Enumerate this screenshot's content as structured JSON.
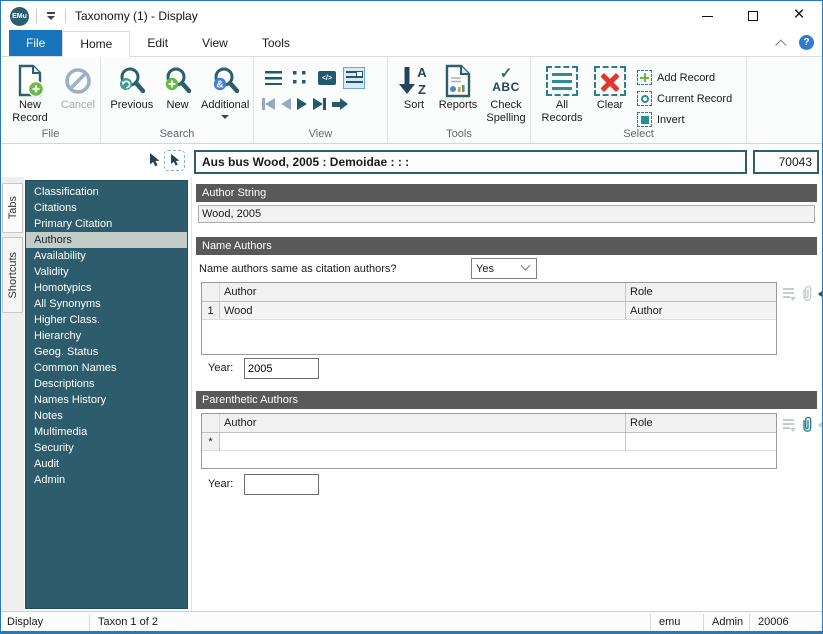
{
  "window": {
    "title": "Taxonomy (1) - Display",
    "logo_text": "EMu"
  },
  "ribbon": {
    "tabs": {
      "file": "File",
      "home": "Home",
      "edit": "Edit",
      "view": "View",
      "tools": "Tools"
    },
    "groups": {
      "file": {
        "label": "File",
        "new_record": "New\nRecord",
        "cancel": "Cancel"
      },
      "search": {
        "label": "Search",
        "previous": "Previous",
        "new": "New",
        "additional": "Additional"
      },
      "view": {
        "label": "View"
      },
      "tools": {
        "label": "Tools",
        "sort": "Sort",
        "reports": "Reports",
        "check_spelling": "Check\nSpelling"
      },
      "select": {
        "label": "Select",
        "all_records": "All\nRecords",
        "clear": "Clear",
        "add_record": "Add Record",
        "current_record": "Current Record",
        "invert": "Invert"
      }
    }
  },
  "record_header": {
    "summary": "Aus bus Wood, 2005 : Demoidae : : :",
    "record_number": "70043"
  },
  "side_tabs": {
    "tabs": "Tabs",
    "shortcuts": "Shortcuts"
  },
  "sidebar": {
    "selected": "Authors",
    "items": [
      "Classification",
      "Citations",
      "Primary Citation",
      "Authors",
      "Availability",
      "Validity",
      "Homotypics",
      "All Synonyms",
      "Higher Class.",
      "Hierarchy",
      "Geog. Status",
      "Common Names",
      "Descriptions",
      "Names History",
      "Notes",
      "Multimedia",
      "Security",
      "Audit",
      "Admin"
    ]
  },
  "content": {
    "author_string": {
      "title": "Author String",
      "value": "Wood, 2005"
    },
    "name_authors": {
      "title": "Name Authors",
      "question": "Name authors same as citation authors?",
      "answer": "Yes",
      "columns": {
        "author": "Author",
        "role": "Role"
      },
      "rows": [
        {
          "num": "1",
          "author": "Wood",
          "role": "Author"
        }
      ],
      "year_label": "Year:",
      "year": "2005"
    },
    "parenthetic_authors": {
      "title": "Parenthetic Authors",
      "columns": {
        "author": "Author",
        "role": "Role"
      },
      "rows": [
        {
          "num": "*",
          "author": "",
          "role": ""
        }
      ],
      "year_label": "Year:",
      "year": ""
    }
  },
  "statusbar": {
    "mode": "Display",
    "record_position": "Taxon 1 of 2",
    "user": "emu",
    "group": "Admin",
    "table_id": "20006"
  },
  "colors": {
    "teal": "#2B5F6E",
    "file_tab_blue": "#1875BC",
    "green": "#67BB43",
    "red": "#E0362B",
    "badge_blue": "#3F7FD6",
    "section_header_gray": "#595959"
  }
}
